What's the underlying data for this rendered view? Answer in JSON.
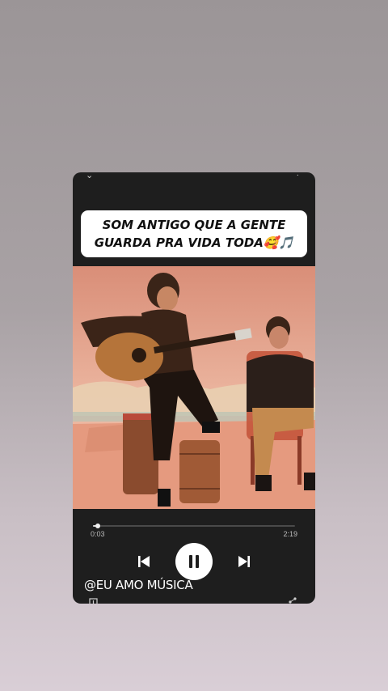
{
  "story_card": {
    "collapse_icon": "chevron-down-icon",
    "menu_icon": "more-dots-icon",
    "caption": "SOM ANTIGO QUE A GENTE GUARDA PRA VIDA TODA🥰🎵"
  },
  "video": {
    "description_icon": "video-frame"
  },
  "player": {
    "elapsed": "0:03",
    "total": "2:19",
    "progress": 0.022,
    "prev_icon": "skip-previous-icon",
    "pause_icon": "pause-icon",
    "next_icon": "skip-next-icon"
  },
  "account": {
    "handle": "@EU AMO MÚSICA"
  },
  "colors": {
    "card_bg": "#1e1e1e",
    "caption_bg": "#ffffff",
    "play_button": "#ffffff"
  }
}
